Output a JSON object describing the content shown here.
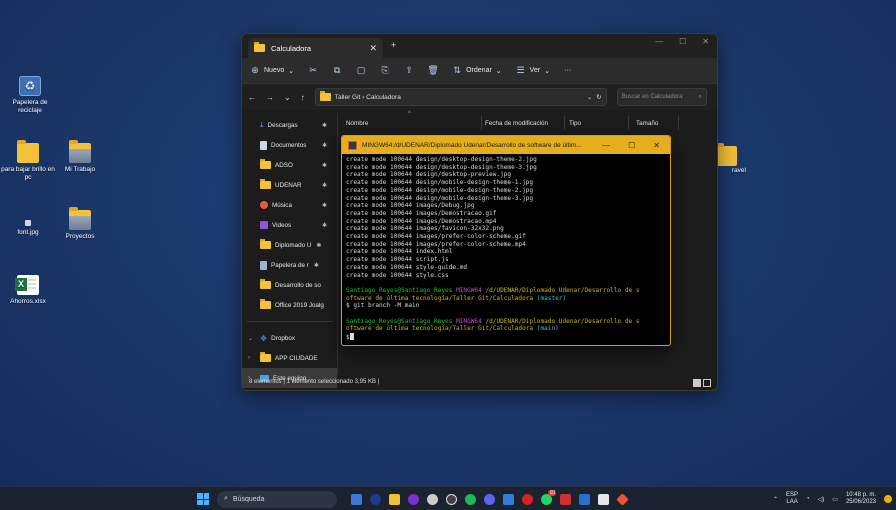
{
  "desktop": {
    "icons": [
      {
        "label": "Papelera de reciclaje"
      },
      {
        "label": "para bajar brillo en pc"
      },
      {
        "label": "Mi Trabajo"
      },
      {
        "label": "font.jpg"
      },
      {
        "label": "Proyectos"
      },
      {
        "label": "Ahorros.xlsx"
      },
      {
        "label": "ravel"
      }
    ]
  },
  "explorer": {
    "tab_title": "Calculadora",
    "tab_close": "✕",
    "tab_add": "+",
    "window_controls": [
      "—",
      "☐",
      "✕"
    ],
    "toolbar": {
      "new_label": "Nuevo",
      "sort_label": "Ordenar",
      "view_label": "Ver",
      "more_label": "···"
    },
    "address": {
      "crumbs": "Taller Git  ›  Calculadora",
      "search_placeholder": "Buscar en Calculadora"
    },
    "nav": [
      {
        "label": "Descargas"
      },
      {
        "label": "Documentos"
      },
      {
        "label": "ADSO"
      },
      {
        "label": "UDENAR"
      },
      {
        "label": "Música"
      },
      {
        "label": "Videos"
      },
      {
        "label": "Diplomado U"
      },
      {
        "label": "Papelera de r"
      },
      {
        "label": "Desarrollo de so"
      },
      {
        "label": "Office 2019 Joalg"
      },
      {
        "label": "Dropbox"
      },
      {
        "label": "APP CIUDADE"
      },
      {
        "label": "Este equipo"
      }
    ],
    "columns": {
      "name": "Nombre",
      "modified": "Fecha de modificación",
      "type": "Tipo",
      "size": "Tamaño"
    },
    "status": "8 elementos  |  1 elemento seleccionado 3,95 KB  |"
  },
  "bash": {
    "title": "MINGW64:/d/UDENAR/Diplomado Udenar/Desarrollo de software de últim...",
    "controls": [
      "—",
      "☐",
      "✕"
    ],
    "output_lines": [
      "create mode 100644 design/desktop-design-theme-2.jpg",
      "create mode 100644 design/desktop-design-theme-3.jpg",
      "create mode 100644 design/desktop-preview.jpg",
      "create mode 100644 design/mobile-design-theme-1.jpg",
      "create mode 100644 design/mobile-design-theme-2.jpg",
      "create mode 100644 design/mobile-design-theme-3.jpg",
      "create mode 100644 images/Debug.jpg",
      "create mode 100644 images/Demostracao.gif",
      "create mode 100644 images/Demostracao.mp4",
      "create mode 100644 images/favicon-32x32.png",
      "create mode 100644 images/prefer-color-scheme.gif",
      "create mode 100644 images/prefer-color-scheme.mp4",
      "create mode 100644 index.html",
      "create mode 100644 script.js",
      "create mode 100644 style-guide.md",
      "create mode 100644 style.css"
    ],
    "prompt1": {
      "user": "Santiago_Reyes@Santiago_Reyes",
      "env": "MINGW64",
      "path_a": "/d/UDENAR/Diplomado Udenar/Desarrollo de s",
      "path_b": "oftware de última tecnología/Taller Git/Calculadora",
      "branch": "(master)"
    },
    "command": "$ git branch -M main",
    "prompt2": {
      "user": "Santiago_Reyes@Santiago_Reyes",
      "env": "MINGW64",
      "path_a": "/d/UDENAR/Diplomado Udenar/Desarrollo de s",
      "path_b": "oftware de última tecnología/Taller Git/Calculadora",
      "branch": "(main)"
    },
    "prompt_symbol": "$"
  },
  "taskbar": {
    "search_label": "Búsqueda",
    "lang_top": "ESP",
    "lang_bottom": "LAA",
    "time": "10:48 p. m.",
    "date": "25/06/2023",
    "whatsapp_badge": "10"
  }
}
